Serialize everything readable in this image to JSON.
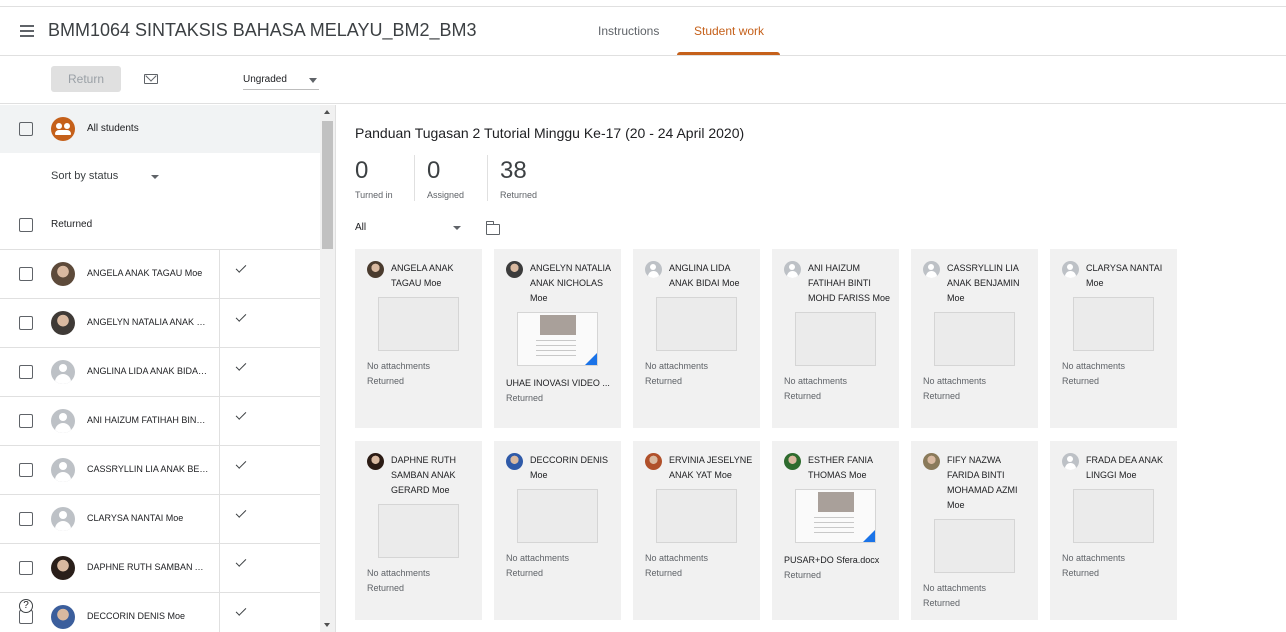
{
  "header": {
    "course_title": "BMM1064 SINTAKSIS BAHASA MELAYU_BM2_BM3",
    "tabs": [
      {
        "label": "Instructions",
        "active": false
      },
      {
        "label": "Student work",
        "active": true
      }
    ],
    "accent_color": "#c5601a"
  },
  "toolbar": {
    "return_label": "Return",
    "mail_icon": "mail-icon",
    "grade_filter": "Ungraded"
  },
  "sidebar": {
    "all_students_label": "All students",
    "sort_label": "Sort by status",
    "section_label": "Returned",
    "students": [
      {
        "name": "ANGELA ANAK TAGAU Moe",
        "avatar": "photo",
        "returned": true
      },
      {
        "name": "ANGELYN NATALIA ANAK NICHOLAS Moe",
        "avatar": "photo",
        "returned": true
      },
      {
        "name": "ANGLINA LIDA ANAK BIDAI Moe",
        "avatar": "generic",
        "returned": true
      },
      {
        "name": "ANI HAIZUM FATIHAH BINTI MOHD FARISS Moe",
        "avatar": "generic",
        "returned": true
      },
      {
        "name": "CASSRYLLIN LIA ANAK BENJAMIN Moe",
        "avatar": "generic",
        "returned": true
      },
      {
        "name": "CLARYSA NANTAI Moe",
        "avatar": "generic",
        "returned": true
      },
      {
        "name": "DAPHNE RUTH SAMBAN ANAK GERARD Moe",
        "avatar": "photo",
        "returned": true
      },
      {
        "name": "DECCORIN DENIS Moe",
        "avatar": "photo",
        "returned": true
      }
    ]
  },
  "main": {
    "assignment_title": "Panduan Tugasan 2 Tutorial Minggu Ke-17 (20 - 24 April 2020)",
    "stats": [
      {
        "value": "0",
        "label": "Turned in"
      },
      {
        "value": "0",
        "label": "Assigned"
      },
      {
        "value": "38",
        "label": "Returned"
      }
    ],
    "filter_label": "All",
    "cards": [
      {
        "name": "ANGELA ANAK TAGAU Moe",
        "avatar": "photo",
        "attachment": "No attachments",
        "status": "Returned",
        "doc": false
      },
      {
        "name": "ANGELYN NATALIA ANAK NICHOLAS Moe",
        "avatar": "photo",
        "attachment": "UHAE INOVASI VIDEO ...",
        "status": "Returned",
        "doc": true
      },
      {
        "name": "ANGLINA LIDA ANAK BIDAI Moe",
        "avatar": "generic",
        "attachment": "No attachments",
        "status": "Returned",
        "doc": false
      },
      {
        "name": "ANI HAIZUM FATIHAH BINTI MOHD FARISS Moe",
        "avatar": "generic",
        "attachment": "No attachments",
        "status": "Returned",
        "doc": false
      },
      {
        "name": "CASSRYLLIN LIA ANAK BENJAMIN Moe",
        "avatar": "generic",
        "attachment": "No attachments",
        "status": "Returned",
        "doc": false
      },
      {
        "name": "CLARYSA NANTAI Moe",
        "avatar": "generic",
        "attachment": "No attachments",
        "status": "Returned",
        "doc": false
      },
      {
        "name": "DAPHNE RUTH SAMBAN ANAK GERARD Moe",
        "avatar": "photo",
        "attachment": "No attachments",
        "status": "Returned",
        "doc": false
      },
      {
        "name": "DECCORIN DENIS Moe",
        "avatar": "photo",
        "attachment": "No attachments",
        "status": "Returned",
        "doc": false
      },
      {
        "name": "ERVINIA JESELYNE ANAK YAT Moe",
        "avatar": "photo",
        "attachment": "No attachments",
        "status": "Returned",
        "doc": false
      },
      {
        "name": "ESTHER FANIA THOMAS Moe",
        "avatar": "photo",
        "attachment": "PUSAR+DO Sfera.docx",
        "status": "Returned",
        "doc": true
      },
      {
        "name": "FIFY NAZWA FARIDA BINTI MOHAMAD AZMI Moe",
        "avatar": "photo",
        "attachment": "No attachments",
        "status": "Returned",
        "doc": false
      },
      {
        "name": "FRADA DEA ANAK LINGGI Moe",
        "avatar": "generic",
        "attachment": "No attachments",
        "status": "Returned",
        "doc": false
      }
    ]
  }
}
